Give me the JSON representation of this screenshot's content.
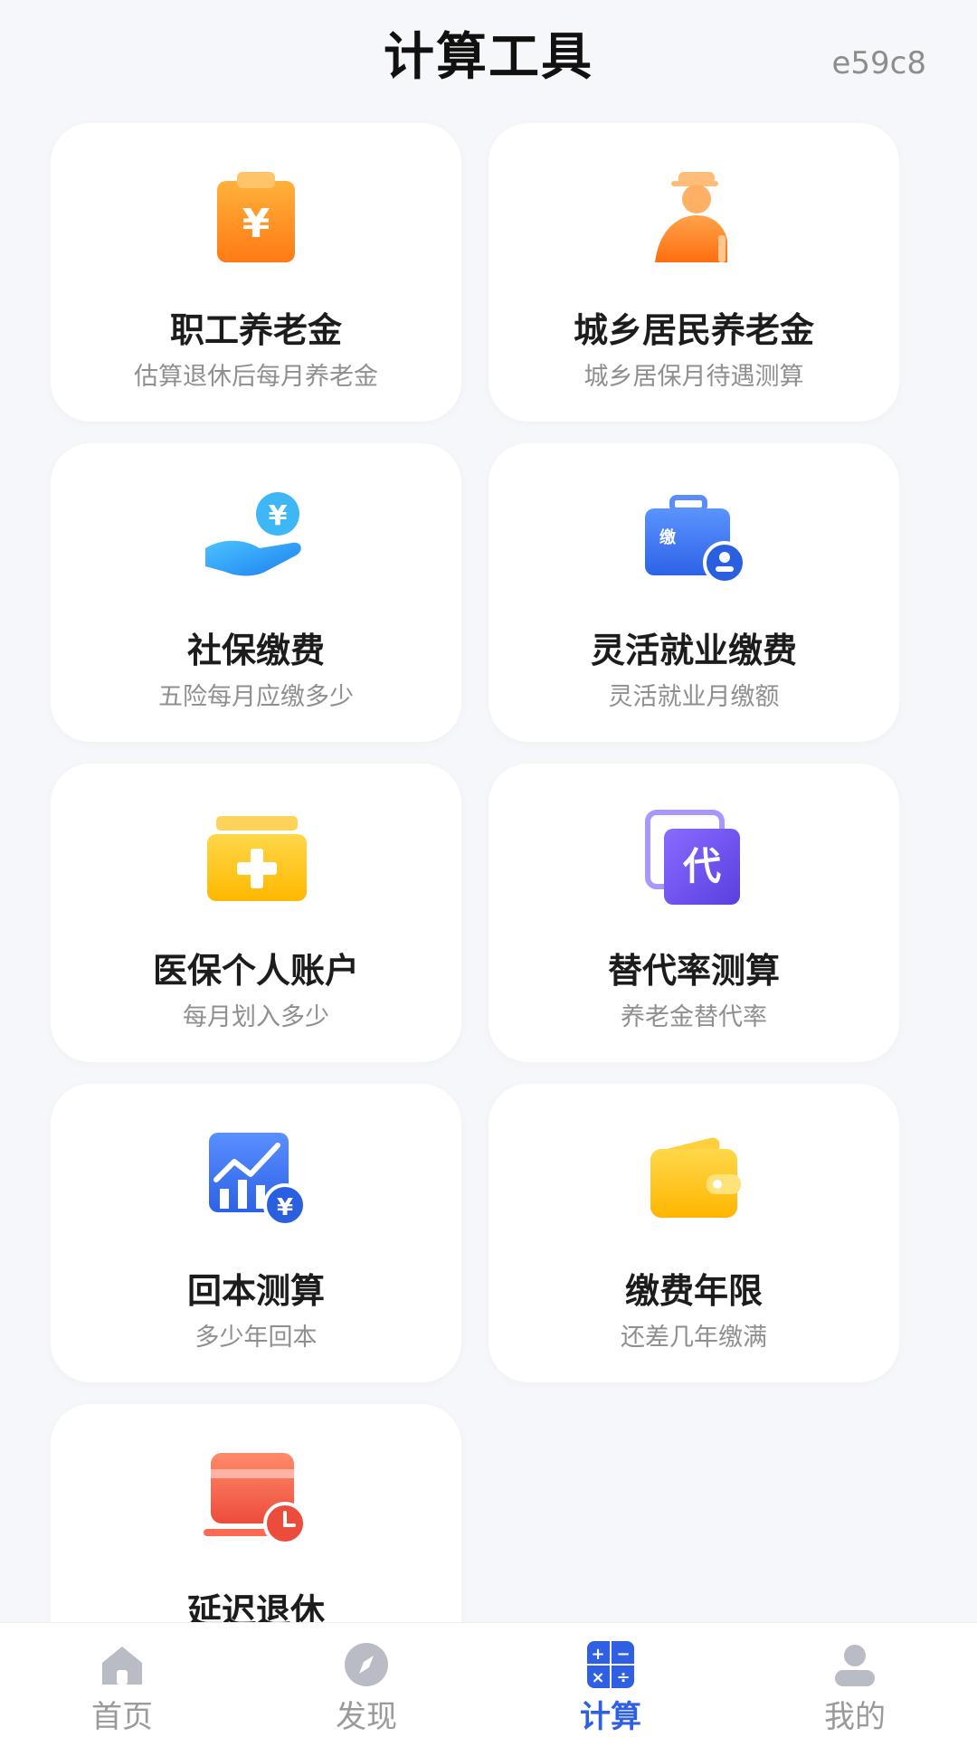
{
  "header": {
    "title": "计算工具",
    "build_tag": "e59c8"
  },
  "tools": [
    {
      "title": "职工养老金",
      "subtitle": "估算退休后每月养老金",
      "icon": "clipboard-yuan-icon"
    },
    {
      "title": "城乡居民养老金",
      "subtitle": "城乡居保月待遇测算",
      "icon": "elderly-person-icon"
    },
    {
      "title": "社保缴费",
      "subtitle": "五险每月应缴多少",
      "icon": "hand-coin-icon"
    },
    {
      "title": "灵活就业缴费",
      "subtitle": "灵活就业月缴额",
      "icon": "briefcase-person-icon",
      "icon_text": "缴"
    },
    {
      "title": "医保个人账户",
      "subtitle": "每月划入多少",
      "icon": "medical-box-icon"
    },
    {
      "title": "替代率测算",
      "subtitle": "养老金替代率",
      "icon": "substitute-card-icon",
      "icon_text": "代"
    },
    {
      "title": "回本测算",
      "subtitle": "多少年回本",
      "icon": "chart-coin-icon"
    },
    {
      "title": "缴费年限",
      "subtitle": "还差几年缴满",
      "icon": "wallet-icon"
    },
    {
      "title": "延迟退休",
      "subtitle": "",
      "icon": "card-clock-icon"
    }
  ],
  "tabbar": {
    "items": [
      {
        "label": "首页",
        "icon": "home-icon",
        "active": false
      },
      {
        "label": "发现",
        "icon": "compass-icon",
        "active": false
      },
      {
        "label": "计算",
        "icon": "calculator-icon",
        "active": true
      },
      {
        "label": "我的",
        "icon": "user-icon",
        "active": false
      }
    ]
  },
  "colors": {
    "accent": "#2f5fe3",
    "orange": "#ff8a1f",
    "blue": "#3b7bf0",
    "yellow": "#ffc21a",
    "purple": "#7a5af0",
    "red": "#f0584a"
  }
}
